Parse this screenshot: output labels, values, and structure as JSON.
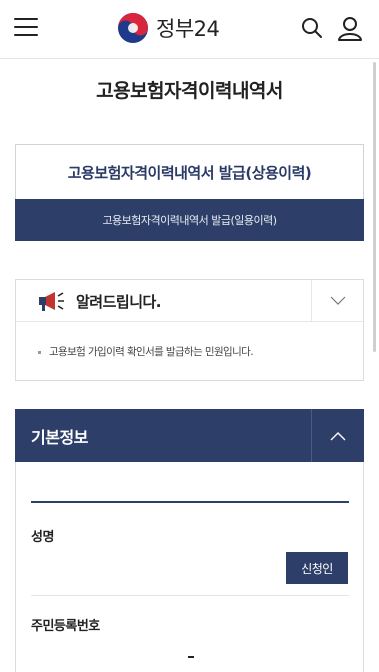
{
  "header": {
    "logo_text": "정부24",
    "icons": {
      "menu": "hamburger-menu-icon",
      "logo": "taegeuk-logo-icon",
      "search": "search-icon",
      "user": "user-icon"
    }
  },
  "page": {
    "title": "고용보험자격이력내역서"
  },
  "tabs": [
    {
      "label": "고용보험자격이력내역서 발급(상용이력)",
      "active": true
    },
    {
      "label": "고용보험자격이력내역서 발급(일용이력)",
      "active": false
    }
  ],
  "notice": {
    "title": "알려드립니다.",
    "icon": "megaphone-icon",
    "toggle_icon": "chevron-down-icon",
    "text": "고용보험 가입이력 확인서를 발급하는 민원입니다."
  },
  "basic_info": {
    "title": "기본정보",
    "toggle_icon": "chevron-up-icon",
    "name_label": "성명",
    "name_value": "",
    "applicant_button": "신청인",
    "rrn_label": "주민등록번호",
    "rrn_value": ""
  },
  "colors": {
    "navy": "#2d3e68",
    "title_navy": "#2a3a66",
    "border": "#d9dce1"
  }
}
